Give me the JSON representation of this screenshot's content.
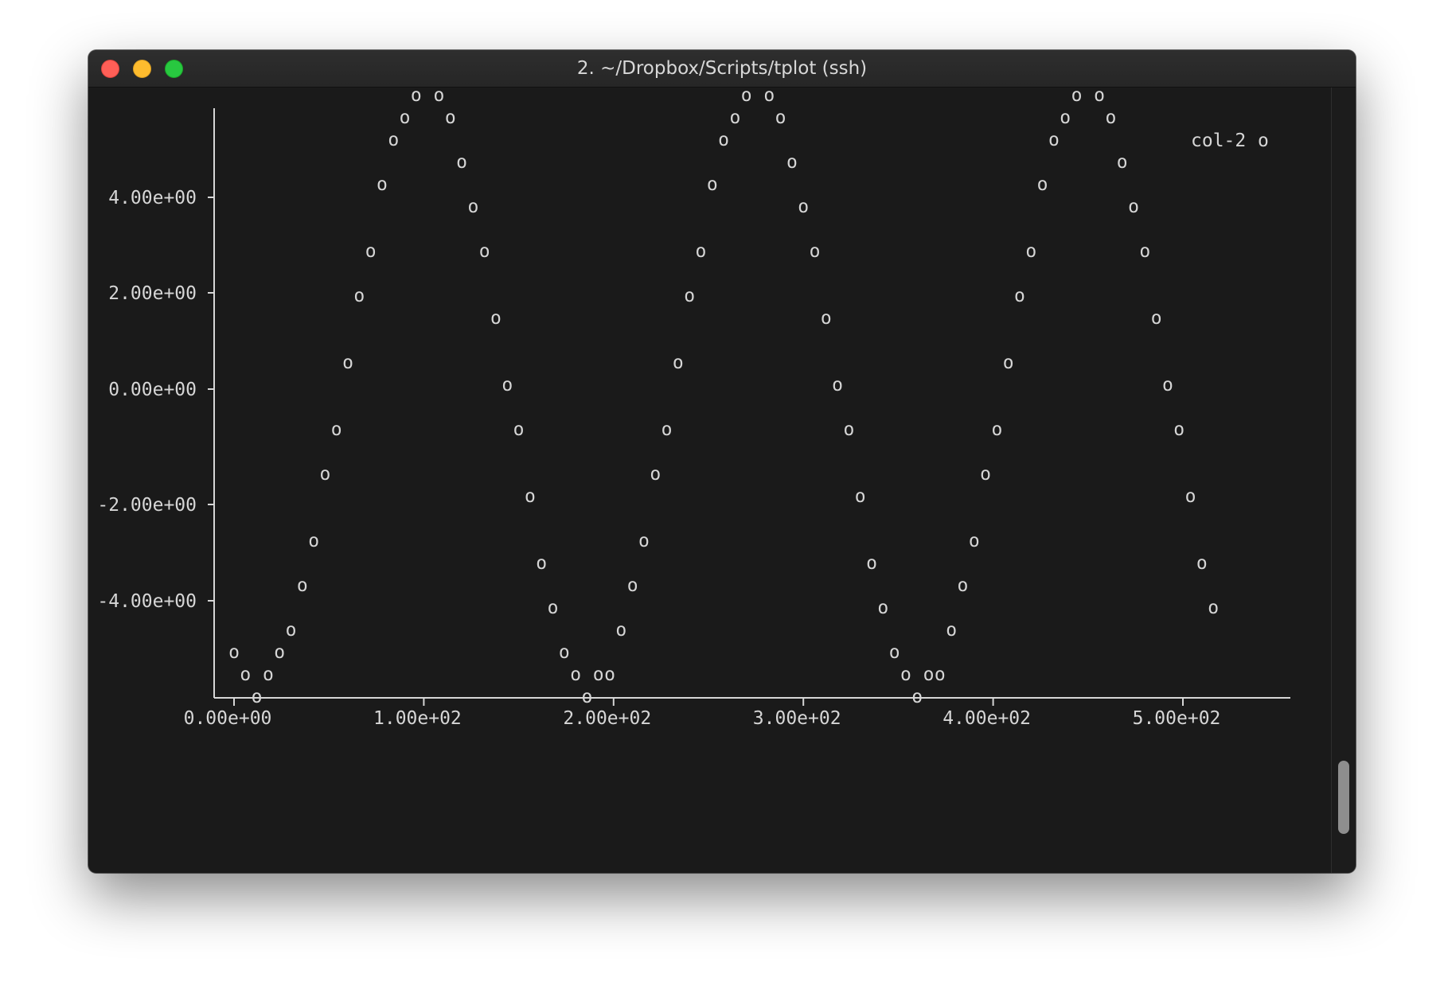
{
  "window": {
    "title": "2. ~/Dropbox/Scripts/tplot (ssh)"
  },
  "terminal": {
    "prompt": "$"
  },
  "colors": {
    "background": "#1a1a1a",
    "foreground": "#d6d6d6",
    "close": "#ff5f57",
    "minimize": "#febc2e",
    "maximize": "#28c840"
  },
  "chart_data": {
    "type": "scatter",
    "marker": "o",
    "legend": {
      "label": "col-2",
      "marker": "o",
      "placement": "top-right"
    },
    "y_tick_labels": [
      "4.00e+00",
      "2.00e+00",
      "0.00e+00",
      "-2.00e+00",
      "-4.00e+00"
    ],
    "y_ticks": [
      4,
      2,
      0,
      -2,
      -4
    ],
    "x_tick_labels": [
      "0.00e+00",
      "1.00e+02",
      "2.00e+02",
      "3.00e+02",
      "4.00e+02",
      "5.00e+02"
    ],
    "x_ticks": [
      0,
      100,
      200,
      300,
      400,
      500
    ],
    "xlim": [
      -30,
      537
    ],
    "ylim": [
      -5.5,
      5.5
    ],
    "grid": false,
    "series": [
      {
        "name": "col-2",
        "x": [
          0,
          6,
          12,
          18,
          24,
          30,
          36,
          42,
          48,
          54,
          60,
          66,
          72,
          78,
          84,
          90,
          96,
          102,
          108,
          114,
          120,
          126,
          132,
          138,
          144,
          150,
          156,
          162,
          168,
          174,
          180,
          186,
          192,
          198,
          204,
          210,
          216,
          222,
          228,
          234,
          240,
          246,
          252,
          258,
          264,
          270,
          276,
          282,
          288,
          294,
          300,
          306,
          312,
          318,
          324,
          330,
          336,
          342,
          348,
          354,
          360,
          366,
          372,
          378,
          384,
          390,
          396,
          402,
          408,
          414,
          420,
          426,
          432,
          438,
          444,
          450,
          456,
          462,
          468,
          474,
          480,
          486,
          492,
          498,
          504,
          510,
          516
        ],
        "y": [
          -4.6,
          -5.1,
          -5.5,
          -5.3,
          -4.9,
          -4.4,
          -3.6,
          -2.7,
          -1.7,
          -0.6,
          0.5,
          1.6,
          2.6,
          3.5,
          4.3,
          4.9,
          5.3,
          5.5,
          5.3,
          4.9,
          4.2,
          3.4,
          2.4,
          1.3,
          0.2,
          -0.9,
          -2.0,
          -3.0,
          -3.9,
          -4.6,
          -5.1,
          -5.4,
          -5.3,
          -5.0,
          -4.4,
          -3.6,
          -2.7,
          -1.7,
          -0.6,
          0.5,
          1.6,
          2.6,
          3.5,
          4.3,
          4.9,
          5.3,
          5.5,
          5.3,
          4.9,
          4.2,
          3.4,
          2.4,
          1.3,
          0.2,
          -0.9,
          -2.0,
          -3.0,
          -3.9,
          -4.6,
          -5.1,
          -5.4,
          -5.3,
          -5.0,
          -4.4,
          -3.6,
          -2.7,
          -1.7,
          -0.6,
          0.5,
          1.6,
          2.6,
          3.5,
          4.3,
          4.9,
          5.3,
          5.5,
          5.3,
          4.9,
          4.2,
          3.4,
          2.4,
          1.3,
          0.2,
          -0.9,
          -2.0,
          -3.0,
          -3.9
        ]
      }
    ]
  }
}
